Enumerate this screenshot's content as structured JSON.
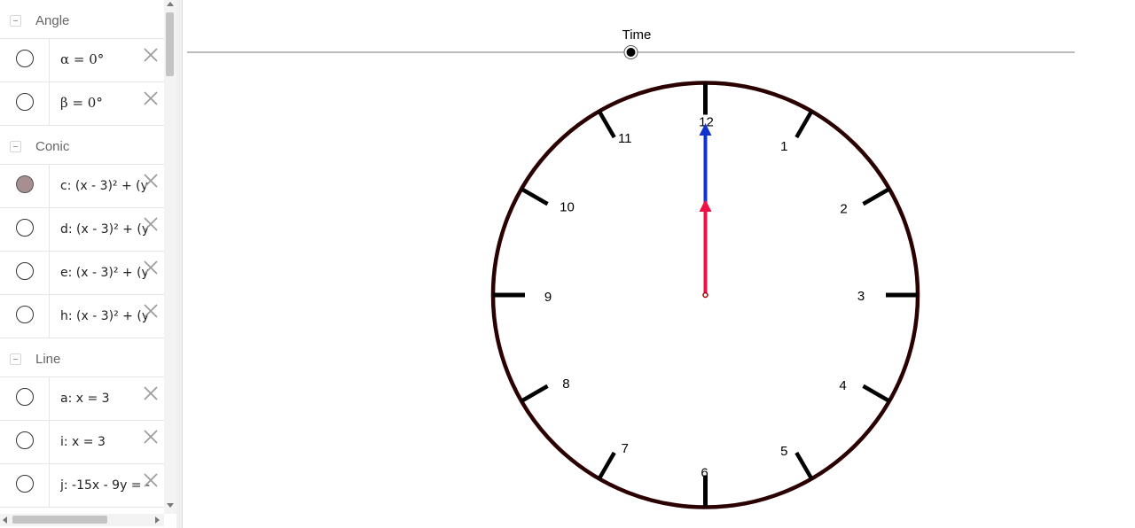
{
  "algebra": {
    "groups": [
      {
        "label": "Angle",
        "items": [
          {
            "expr": "α = 0°",
            "visible": false
          },
          {
            "expr": "β = 0°",
            "visible": false
          }
        ]
      },
      {
        "label": "Conic",
        "items": [
          {
            "expr": "c: (x - 3)² + (y",
            "visible": true
          },
          {
            "expr": "d: (x - 3)² + (y",
            "visible": false
          },
          {
            "expr": "e: (x - 3)² + (y",
            "visible": false
          },
          {
            "expr": "h: (x - 3)² + (y",
            "visible": false
          }
        ]
      },
      {
        "label": "Line",
        "items": [
          {
            "expr": "a: x = 3",
            "visible": false
          },
          {
            "expr": "i: x = 3",
            "visible": false
          },
          {
            "expr": "j: -15x - 9y = -",
            "visible": false
          }
        ]
      }
    ]
  },
  "slider": {
    "label": "Time",
    "value_fraction": 0.5
  },
  "clock": {
    "numbers": [
      "12",
      "1",
      "2",
      "3",
      "4",
      "5",
      "6",
      "7",
      "8",
      "9",
      "10",
      "11"
    ],
    "rim_color": "#2a0000",
    "tick_color": "#000000",
    "minute_hand_color": "#1133cc",
    "hour_hand_color": "#ee1144",
    "hour_hand_angle_deg": 0,
    "minute_hand_angle_deg": 0
  }
}
